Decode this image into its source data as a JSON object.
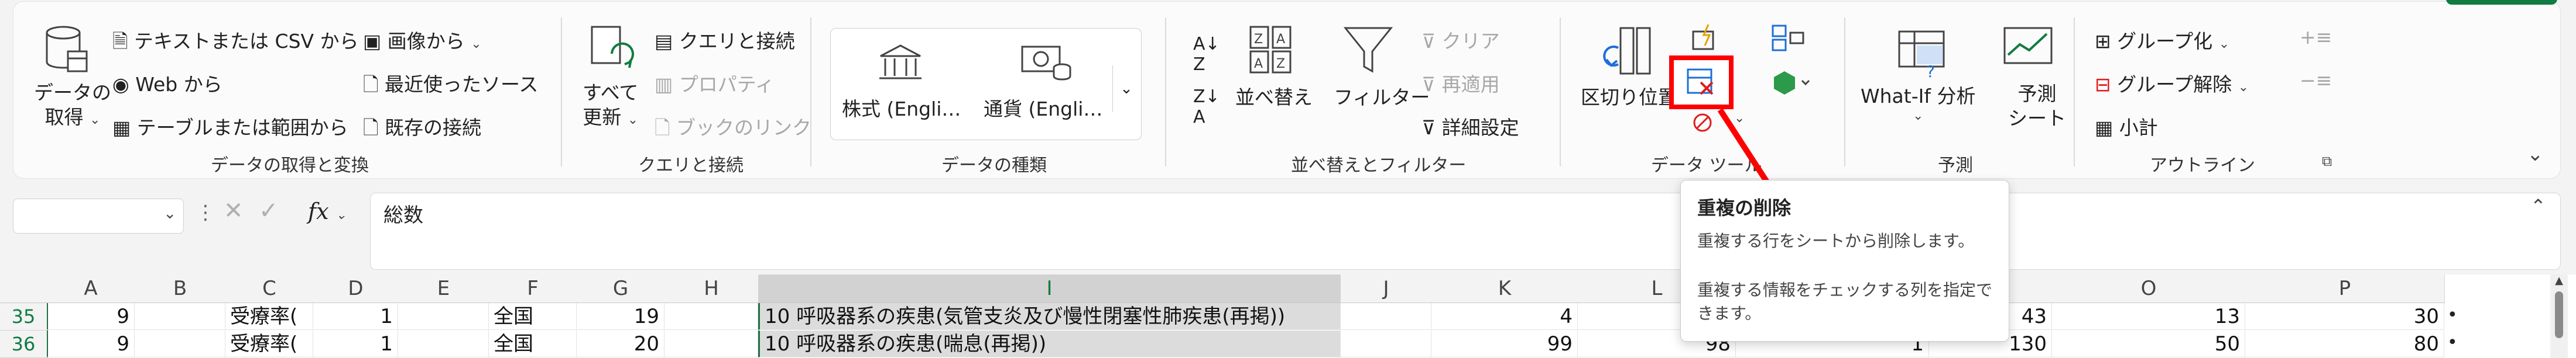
{
  "ribbon": {
    "groups": {
      "get_transform": "データの取得と変換",
      "queries": "クエリと接続",
      "data_types": "データの種類",
      "sort_filter": "並べ替えとフィルター",
      "data_tools": "データ ツール",
      "forecast": "予測",
      "outline": "アウトライン"
    },
    "get_data": {
      "line1": "データの",
      "line2": "取得"
    },
    "from_text_csv": "テキストまたは CSV から",
    "from_web": "Web から",
    "from_table": "テーブルまたは範囲から",
    "from_picture": "画像から",
    "recent_sources": "最近使ったソース",
    "existing_connections": "既存の接続",
    "refresh_all": {
      "line1": "すべて",
      "line2": "更新"
    },
    "queries_connections": "クエリと接続",
    "properties": "プロパティ",
    "edit_links": "ブックのリンク",
    "stocks": "株式 (Engli…",
    "currencies": "通貨 (Engli…",
    "sort": "並べ替え",
    "filter": "フィルター",
    "clear": "クリア",
    "reapply": "再適用",
    "advanced": "詳細設定",
    "text_to_columns": "区切り位置",
    "what_if": "What-If 分析",
    "forecast_sheet": {
      "line1": "予測",
      "line2": "シート"
    },
    "group": "グループ化",
    "ungroup": "グループ解除",
    "subtotal": "小計"
  },
  "formula_bar": {
    "namebox_value": "",
    "fx_label": "fx",
    "content": "総数"
  },
  "tooltip": {
    "title": "重複の削除",
    "desc1": "重複する行をシートから削除します。",
    "desc2": "重複する情報をチェックする列を指定できます。"
  },
  "sheet": {
    "columns": [
      "A",
      "B",
      "C",
      "D",
      "E",
      "F",
      "G",
      "H",
      "I",
      "J",
      "K",
      "L",
      "M",
      "N",
      "O",
      "P"
    ],
    "rows": [
      {
        "num": "35",
        "A": "9",
        "C": "受療率(",
        "D": "1",
        "F": "全国",
        "G": "19",
        "I": "10 呼吸器系の疾患(気管支炎及び慢性閉塞性肺疾患(再掲))",
        "K": "4",
        "N": "43",
        "O": "13",
        "P": "30"
      },
      {
        "num": "36",
        "A": "9",
        "C": "受療率(",
        "D": "1",
        "F": "全国",
        "G": "20",
        "I": "10 呼吸器系の疾患(喘息(再掲))",
        "K": "99",
        "L": "98",
        "M": "1",
        "N": "130",
        "O": "50",
        "P": "80"
      }
    ]
  },
  "colors": {
    "highlight": "#ff0000",
    "excel_green": "#107c41"
  }
}
